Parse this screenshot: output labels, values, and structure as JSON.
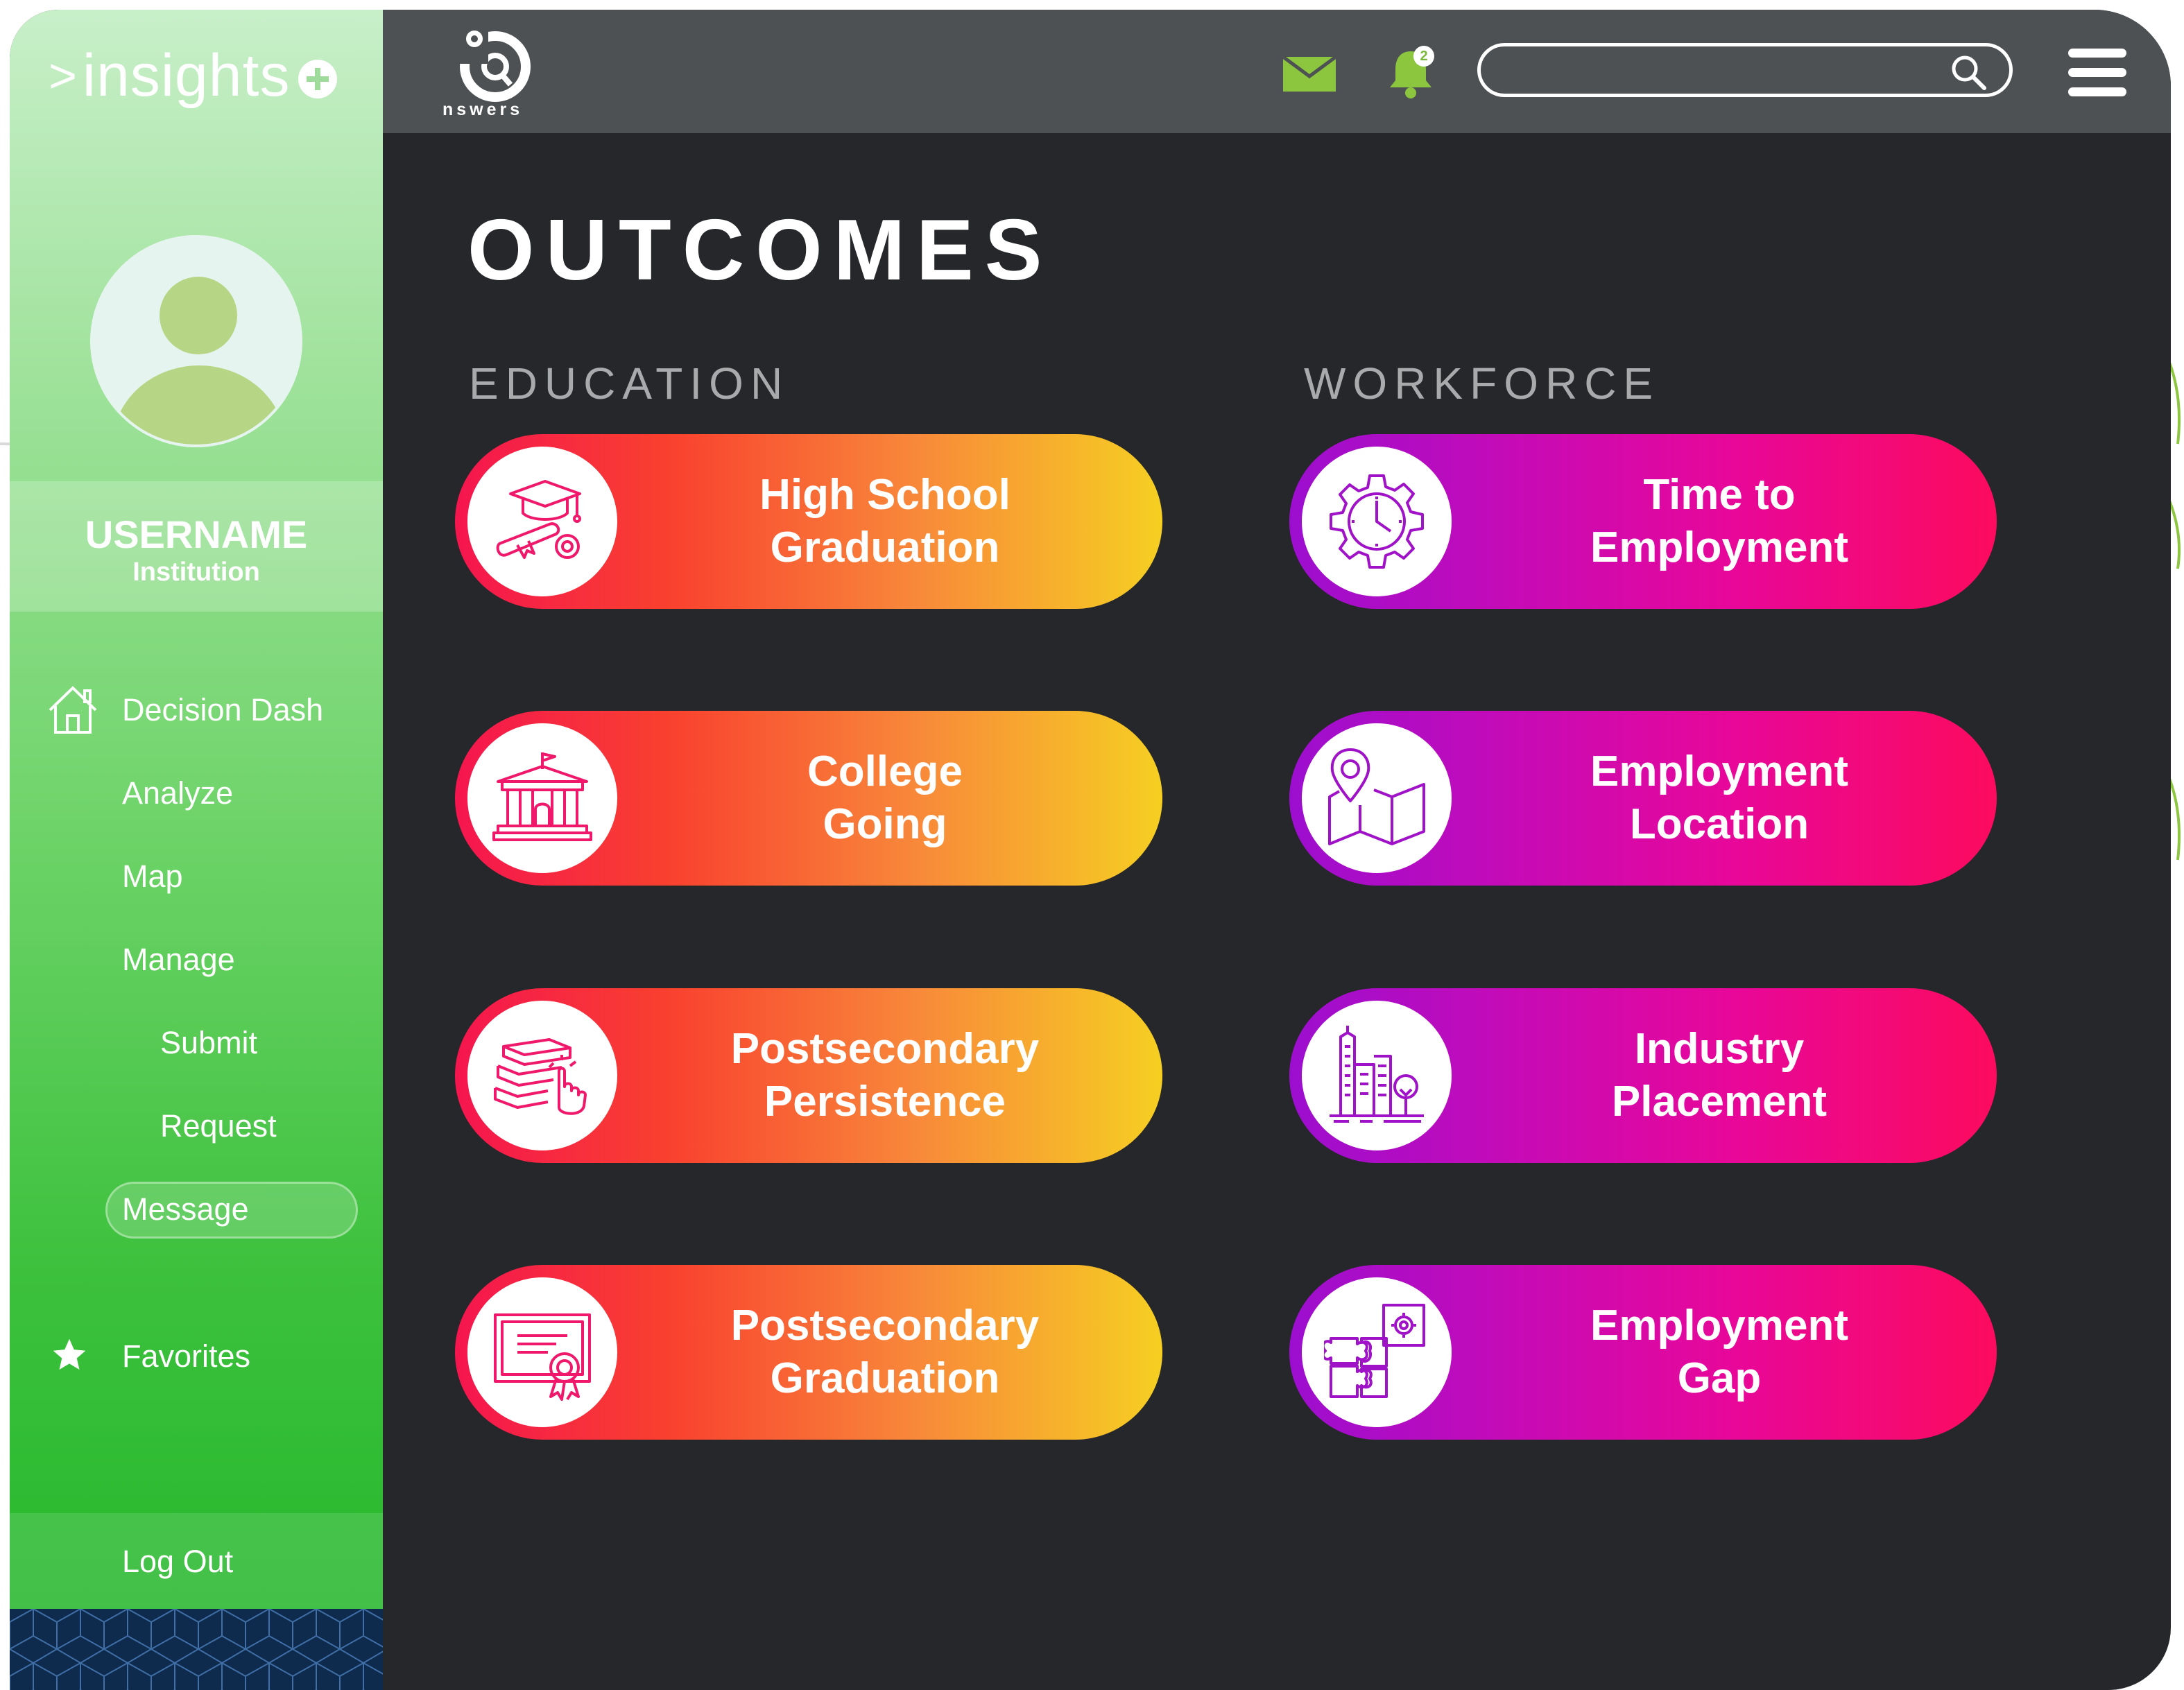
{
  "brand": {
    "caret": ">",
    "name": "insights"
  },
  "user": {
    "username": "USERNAME",
    "institution": "Institution"
  },
  "nav": {
    "items": [
      {
        "label": "Decision Dash"
      },
      {
        "label": "Analyze"
      },
      {
        "label": "Map"
      },
      {
        "label": "Manage"
      },
      {
        "label": "Submit"
      },
      {
        "label": "Request"
      },
      {
        "label": "Message"
      }
    ],
    "favorites": "Favorites",
    "logout": "Log Out"
  },
  "topbar": {
    "logo_text": "nswers",
    "notification_count": "2",
    "search_placeholder": ""
  },
  "main": {
    "title": "OUTCOMES",
    "education": {
      "label": "EDUCATION",
      "cards": [
        {
          "label": "High School\nGraduation",
          "icon": "graduation-cap-diploma-icon"
        },
        {
          "label": "College\nGoing",
          "icon": "college-building-icon"
        },
        {
          "label": "Postsecondary\nPersistence",
          "icon": "books-click-icon"
        },
        {
          "label": "Postsecondary\nGraduation",
          "icon": "certificate-icon"
        }
      ]
    },
    "workforce": {
      "label": "WORKFORCE",
      "cards": [
        {
          "label": "Time to\nEmployment",
          "icon": "gear-clock-icon"
        },
        {
          "label": "Employment\nLocation",
          "icon": "map-pin-icon"
        },
        {
          "label": "Industry\nPlacement",
          "icon": "city-buildings-icon"
        },
        {
          "label": "Employment\nGap",
          "icon": "puzzle-icon"
        }
      ]
    }
  },
  "colors": {
    "sidebar_top": "#c8efc9",
    "sidebar_bottom": "#22b62a",
    "main_bg": "#25272a",
    "topbar_bg": "#4e5154",
    "education_gradient": [
      "#f5154f",
      "#f6cf22"
    ],
    "workforce_gradient": [
      "#9c0ecf",
      "#fc0b5e"
    ],
    "accent_green": "#7ab83c"
  }
}
